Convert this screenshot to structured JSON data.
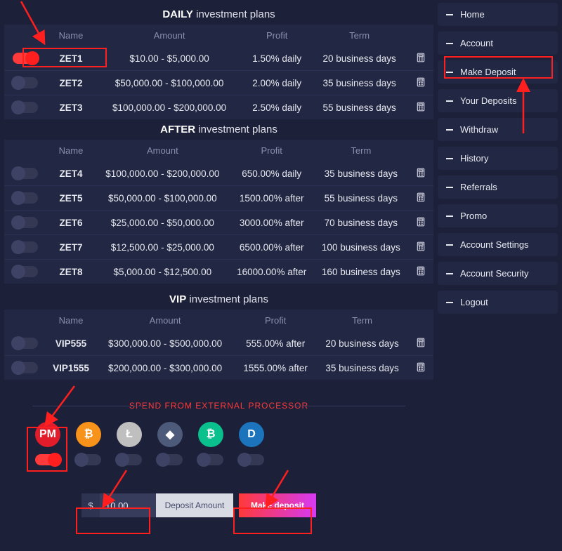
{
  "sections": {
    "daily": {
      "title_bold": "DAILY",
      "title_rest": "investment plans"
    },
    "after": {
      "title_bold": "AFTER",
      "title_rest": "investment plans"
    },
    "vip": {
      "title_bold": "VIP",
      "title_rest": "investment plans"
    }
  },
  "headers": {
    "name": "Name",
    "amount": "Amount",
    "profit": "Profit",
    "term": "Term"
  },
  "plans_daily": [
    {
      "name": "ZET1",
      "amount": "$10.00 - $5,000.00",
      "profit": "1.50% daily",
      "term": "20 business days",
      "on": true
    },
    {
      "name": "ZET2",
      "amount": "$50,000.00 - $100,000.00",
      "profit": "2.00% daily",
      "term": "35 business days",
      "on": false
    },
    {
      "name": "ZET3",
      "amount": "$100,000.00 - $200,000.00",
      "profit": "2.50% daily",
      "term": "55 business days",
      "on": false
    }
  ],
  "plans_after": [
    {
      "name": "ZET4",
      "amount": "$100,000.00 - $200,000.00",
      "profit": "650.00% daily",
      "term": "35 business days",
      "on": false
    },
    {
      "name": "ZET5",
      "amount": "$50,000.00 - $100,000.00",
      "profit": "1500.00% after",
      "term": "55 business days",
      "on": false
    },
    {
      "name": "ZET6",
      "amount": "$25,000.00 - $50,000.00",
      "profit": "3000.00% after",
      "term": "70 business days",
      "on": false
    },
    {
      "name": "ZET7",
      "amount": "$12,500.00 - $25,000.00",
      "profit": "6500.00% after",
      "term": "100 business days",
      "on": false
    },
    {
      "name": "ZET8",
      "amount": "$5,000.00 - $12,500.00",
      "profit": "16000.00% after",
      "term": "160 business days",
      "on": false
    }
  ],
  "plans_vip": [
    {
      "name": "VIP555",
      "amount": "$300,000.00 - $500,000.00",
      "profit": "555.00% after",
      "term": "20 business days",
      "on": false
    },
    {
      "name": "VIP1555",
      "amount": "$200,000.00 - $300,000.00",
      "profit": "1555.00% after",
      "term": "35 business days",
      "on": false
    }
  ],
  "menu": [
    "Home",
    "Account",
    "Make Deposit",
    "Your Deposits",
    "Withdraw",
    "History",
    "Referrals",
    "Promo",
    "Account Settings",
    "Account Security",
    "Logout"
  ],
  "external": {
    "title": "SPEND FROM EXTERNAL PROCESSOR",
    "processors": [
      {
        "id": "pm",
        "label": "PM",
        "bg": "#e21c2a",
        "on": true
      },
      {
        "id": "btc",
        "label": "₿",
        "bg": "#f7931a",
        "on": false
      },
      {
        "id": "ltc",
        "label": "Ł",
        "bg": "#bfbfbf",
        "on": false
      },
      {
        "id": "eth",
        "label": "◆",
        "bg": "#4d5a7a",
        "on": false
      },
      {
        "id": "bch",
        "label": "₿",
        "bg": "#0ac18e",
        "on": false
      },
      {
        "id": "dash",
        "label": "D",
        "bg": "#1c75bc",
        "on": false
      }
    ]
  },
  "deposit": {
    "currency": "$",
    "value": "10.00",
    "label": "Deposit Amount",
    "button": "Make deposit"
  }
}
